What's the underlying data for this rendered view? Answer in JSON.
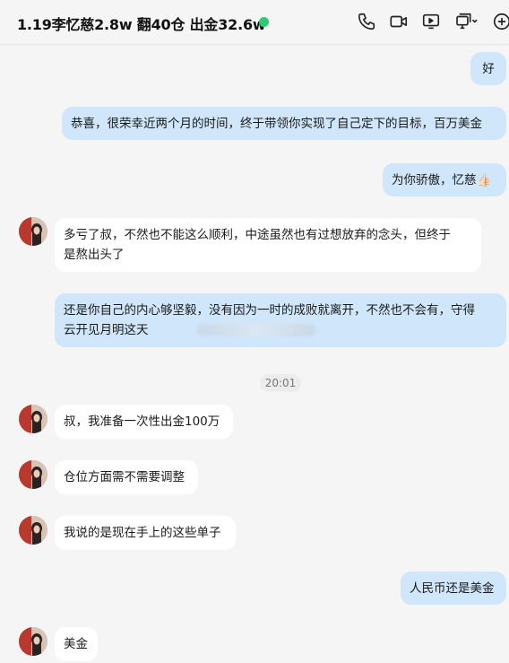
{
  "header": {
    "title": "1.19李忆慈2.8w 翻40仓 出金32.6w",
    "status_color": "#2ecc71",
    "icons": [
      "phone-icon",
      "video-call-icon",
      "screen-share-icon",
      "more-menu-icon",
      "add-icon"
    ]
  },
  "messages": {
    "m1": "好",
    "m2": "恭喜，很荣幸近两个月的时间，终于带领你实现了自己定下的目标，百万美金",
    "m3": "为你骄傲，忆慈👍🏻",
    "m4_line1": "多亏了叔，不然也不能这么顺利，中途虽然也有过想放弃的念头，但终于",
    "m4_line2": "是熬出头了",
    "m5_line1": "还是你自己的内心够坚毅，没有因为一时的成败就离开，不然也不会有，守得",
    "m5_line2": "云开见月明这天",
    "time": "20:01",
    "m6": "叔，我准备一次性出金100万",
    "m7": "仓位方面需不需要调整",
    "m8": "我说的是现在手上的这些单子",
    "m9": "人民币还是美金",
    "m10": "美金"
  },
  "colors": {
    "outgoing_bubble": "#cfe6fb",
    "incoming_bubble": "#ffffff",
    "background": "#f5f5f5"
  }
}
